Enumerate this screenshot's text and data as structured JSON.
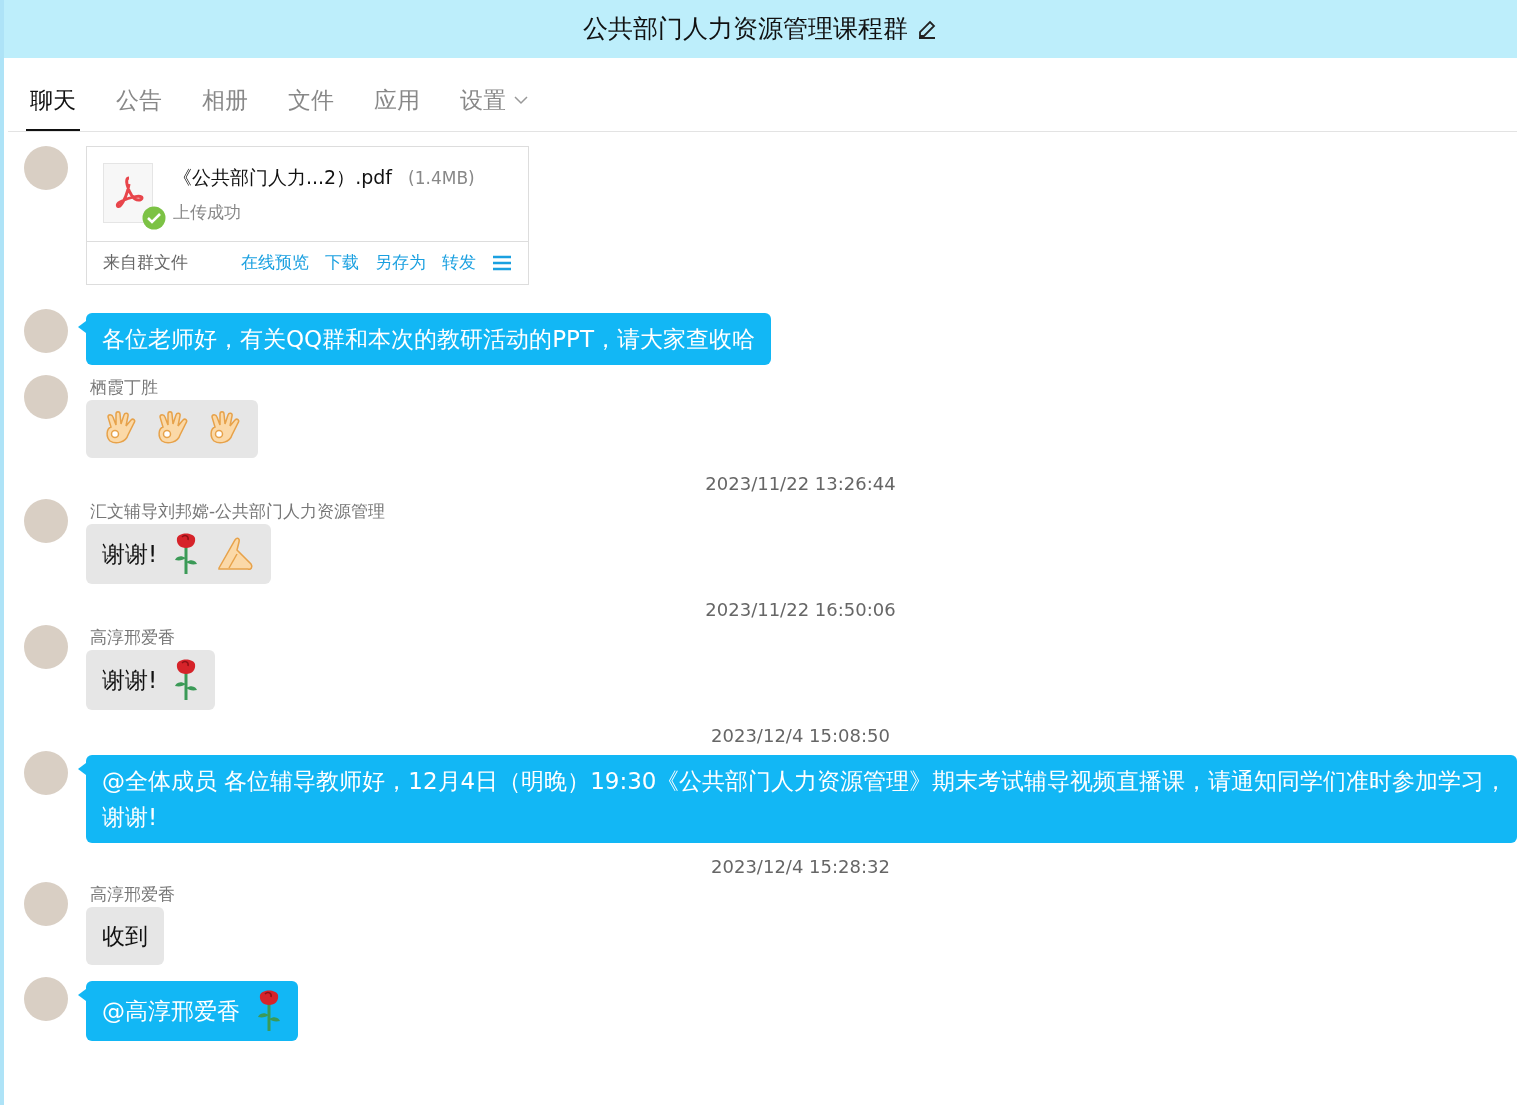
{
  "window": {
    "title": "公共部门人力资源管理课程群"
  },
  "tabs": [
    {
      "label": "聊天",
      "selected": true
    },
    {
      "label": "公告",
      "selected": false
    },
    {
      "label": "相册",
      "selected": false
    },
    {
      "label": "文件",
      "selected": false
    },
    {
      "label": "应用",
      "selected": false
    },
    {
      "label": "设置",
      "selected": false,
      "dropdown": true
    }
  ],
  "messages": [
    {
      "kind": "file",
      "file": {
        "name": "《公共部门人力...2）.pdf",
        "size": "(1.4MB)",
        "status": "上传成功",
        "source": "来自群文件",
        "actions": [
          "在线预览",
          "下载",
          "另存为",
          "转发"
        ]
      }
    },
    {
      "kind": "self",
      "text": "各位老师好，有关QQ群和本次的教研活动的PPT，请大家查收哈"
    },
    {
      "kind": "other",
      "sender": "栖霞丁胜",
      "emojis": [
        {
          "kind": "ok"
        },
        {
          "kind": "ok"
        },
        {
          "kind": "ok"
        }
      ]
    },
    {
      "kind": "time",
      "text": "2023/11/22 13:26:44"
    },
    {
      "kind": "other",
      "sender": "汇文辅导刘邦嫦-公共部门人力资源管理",
      "text": "谢谢!",
      "emojis": [
        {
          "kind": "rose"
        },
        {
          "kind": "pray"
        }
      ]
    },
    {
      "kind": "time",
      "text": "2023/11/22 16:50:06"
    },
    {
      "kind": "other",
      "sender": "高淳邢爱香",
      "text": "谢谢!",
      "emojis": [
        {
          "kind": "rose"
        }
      ]
    },
    {
      "kind": "time",
      "text": "2023/12/4 15:08:50"
    },
    {
      "kind": "self",
      "text": "@全体成员 各位辅导教师好，12月4日（明晚）19:30《公共部门人力资源管理》期末考试辅导视频直播课，请通知同学们准时参加学习，谢谢!"
    },
    {
      "kind": "time",
      "text": "2023/12/4 15:28:32"
    },
    {
      "kind": "other",
      "sender": "高淳邢爱香",
      "text": "收到"
    },
    {
      "kind": "self",
      "text": "@高淳邢爱香",
      "emojis": [
        {
          "kind": "rose"
        }
      ]
    }
  ]
}
